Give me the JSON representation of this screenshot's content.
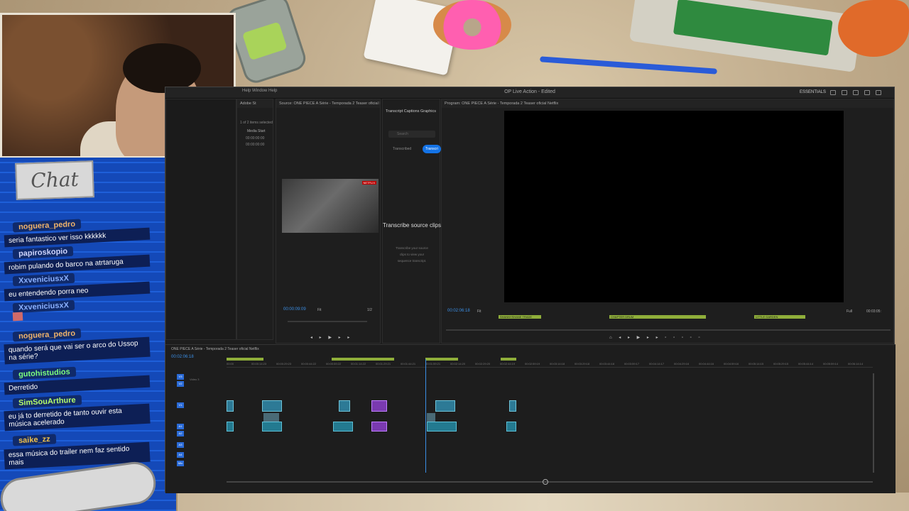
{
  "chat": {
    "title": "Chat",
    "messages": [
      {
        "user": "noguera_pedro",
        "user_color": "#f0b46a",
        "text": "seria fantastico ver isso kkkkkk"
      },
      {
        "user": "papiroskopio",
        "user_color": "#cfd6ff",
        "text": "robim pulando do barco na atrtaruga"
      },
      {
        "user": "XxveniciusxX",
        "user_color": "#8ab0ff",
        "text": "eu entendendo porra neo"
      },
      {
        "user": "XxveniciusxX",
        "user_color": "#8ab0ff",
        "text": ""
      },
      {
        "user": "noguera_pedro",
        "user_color": "#f0b46a",
        "text": "quando será que vai ser o arco do Ussop na série?"
      },
      {
        "user": "gutohistudios",
        "user_color": "#7dff7d",
        "text": "Derretido"
      },
      {
        "user": "SimSouArthure",
        "user_color": "#b6ff6a",
        "text": "eu já to derretido de tanto ouvir esta música acelerado"
      },
      {
        "user": "saike_zz",
        "user_color": "#f0c24a",
        "text": "essa música do trailer nem faz sentido mais"
      }
    ]
  },
  "premiere": {
    "window_title": "OP Live Action - Edited",
    "menu": "Help  Window  Help",
    "workspace_label": "ESSENTIALS",
    "project": {
      "selection_info": "1 of 2 items selected",
      "media_start_label": "Media Start",
      "media_start_1": "00:00:00:00",
      "media_start_2": "00:00:00:00",
      "tab": "Adobe St"
    },
    "source": {
      "title": "Source: ONE PIECE A Série - Temporada 2 Teaser oficial Netflix.mp4   Essential Sound",
      "timecode": "00:00:09:09",
      "fit": "Fit",
      "ratio": "1/2",
      "badge": "NETFLIX"
    },
    "transcript": {
      "tabs": "Transcript   Captions   Graphics",
      "search_placeholder": "Search",
      "transcribed_label": "Transcribed",
      "transcribe_button": "Transcri",
      "heading": "Transcribe source clips",
      "description": "Transcribe your source clips to view your sequence transcript."
    },
    "program": {
      "title": "Program: ONE PIECE A Série - Temporada 2 Teaser oficial Netflix",
      "timecode": "00:02:06:18",
      "fit": "Fit",
      "full": "Full",
      "end_timecode": "00:03:05:",
      "markers": [
        "SHANNYSHANE TRADE",
        "CHAPTER DRUM",
        "LITTLE GARDEN"
      ]
    },
    "timeline": {
      "sequence_name": "ONE PIECE A Série - Temporada 2 Teaser oficial Netflix",
      "timecode": "00:02:06:18",
      "ruler": [
        "00:00",
        "00:00:14:23",
        "00:00:29:23",
        "00:00:44:22",
        "00:00:59:22",
        "00:01:14:22",
        "00:01:29:21",
        "00:01:44:21",
        "00:01:59:21",
        "00:02:14:20",
        "00:02:29:20",
        "00:02:44:19",
        "00:02:59:19",
        "00:03:14:18",
        "00:03:29:18",
        "00:03:44:18",
        "00:03:59:17",
        "00:04:14:17",
        "00:04:29:16",
        "00:04:44:16",
        "00:04:59:16",
        "00:05:14:15",
        "00:05:29:15",
        "00:05:44:14",
        "00:05:59:14",
        "00:06:14:14"
      ],
      "video_track_label": "Video 3",
      "tracks": [
        "V3",
        "V2",
        "V1",
        "A1",
        "A2",
        "A3",
        "A4",
        "Mix"
      ]
    }
  }
}
